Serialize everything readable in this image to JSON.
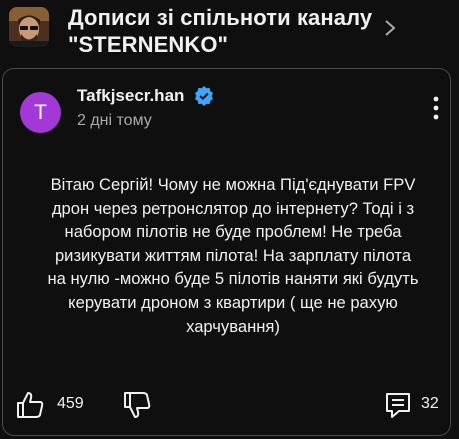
{
  "header": {
    "title_line1": "Дописи зі спільноти каналу",
    "title_line2": "\"STERNENKO\""
  },
  "post": {
    "author_initial": "T",
    "author_name": "Tafkjsecr.han",
    "timestamp": "2 дні тому",
    "lines": [
      "Вітаю Сергій! Чому не можна Під'єднувати FPV",
      "дрон через ретронслятор до інтернету? Тоді і з",
      "набором пілотів не буде проблем! Не треба",
      "ризикувати життям пілота! На зарплату пілота",
      "на нулю -можно буде 5 пілотів наняти які будуть",
      "керувати дроном з квартири ( ще не рахую",
      "харчування)"
    ],
    "like_count": "459",
    "reply_count": "32"
  },
  "colors": {
    "background": "#0f0f0f",
    "avatar": "#a239d6",
    "verified": "#3ea6ff",
    "secondary_text": "#aaaaaa"
  }
}
